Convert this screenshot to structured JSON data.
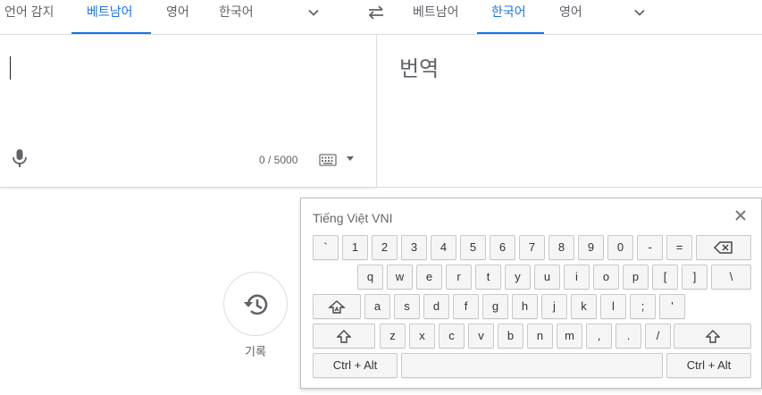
{
  "source_langs": {
    "detect": "언어 감지",
    "vietnamese": "베트남어",
    "english": "영어",
    "korean": "한국어"
  },
  "target_langs": {
    "vietnamese": "베트남어",
    "korean": "한국어",
    "english": "영어"
  },
  "source": {
    "char_count": "0 / 5000"
  },
  "target": {
    "placeholder": "번역"
  },
  "history": {
    "label": "기록"
  },
  "keyboard": {
    "title": "Tiếng Việt VNI",
    "row1": [
      "`",
      "1",
      "2",
      "3",
      "4",
      "5",
      "6",
      "7",
      "8",
      "9",
      "0",
      "-",
      "="
    ],
    "row2": [
      "q",
      "w",
      "e",
      "r",
      "t",
      "y",
      "u",
      "i",
      "o",
      "p",
      "[",
      "]",
      "\\"
    ],
    "row3": [
      "a",
      "s",
      "d",
      "f",
      "g",
      "h",
      "j",
      "k",
      "l",
      ";",
      "'"
    ],
    "row4": [
      "z",
      "x",
      "c",
      "v",
      "b",
      "n",
      "m",
      ",",
      ".",
      "/"
    ],
    "ctrl_alt_left": "Ctrl + Alt",
    "ctrl_alt_right": "Ctrl + Alt"
  },
  "icons": {
    "swap": "swap-arrows-icon",
    "mic": "microphone-icon",
    "keyboard": "keyboard-icon",
    "history": "history-icon",
    "close": "close-icon",
    "backspace": "backspace-icon",
    "shift": "shift-icon",
    "caps": "caps-lock-icon"
  },
  "colors": {
    "accent": "#1a73e8",
    "text": "#3c4043",
    "muted": "#5f6368"
  }
}
